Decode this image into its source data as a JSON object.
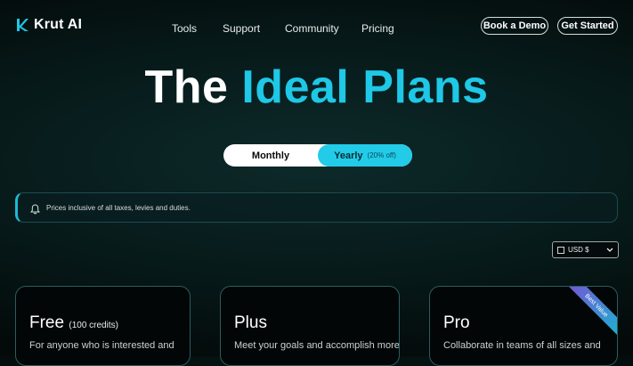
{
  "brand": {
    "name": "Krut AI",
    "icon": "k-logo-icon",
    "accent": "#1ec8e6"
  },
  "nav": {
    "links": [
      "Tools",
      "Support",
      "Community",
      "Pricing"
    ],
    "book_demo": "Book a Demo",
    "get_started": "Get Started"
  },
  "hero": {
    "title_white": "The",
    "title_accent": "Ideal Plans"
  },
  "billing_toggle": {
    "monthly": "Monthly",
    "yearly": "Yearly",
    "yearly_badge": "(20% off)",
    "selected": "Yearly"
  },
  "notice": {
    "icon": "bell-icon",
    "text": "Prices inclusive of all taxes, levies and duties."
  },
  "currency": {
    "icon": "flag-icon",
    "selected": "USD $"
  },
  "plans": [
    {
      "name": "Free",
      "credits": "(100 credits)",
      "description": "For anyone who is interested and"
    },
    {
      "name": "Plus",
      "description": "Meet your goals and accomplish more"
    },
    {
      "name": "Pro",
      "description": "Collaborate in teams of all sizes and",
      "ribbon": "Best Value"
    }
  ]
}
